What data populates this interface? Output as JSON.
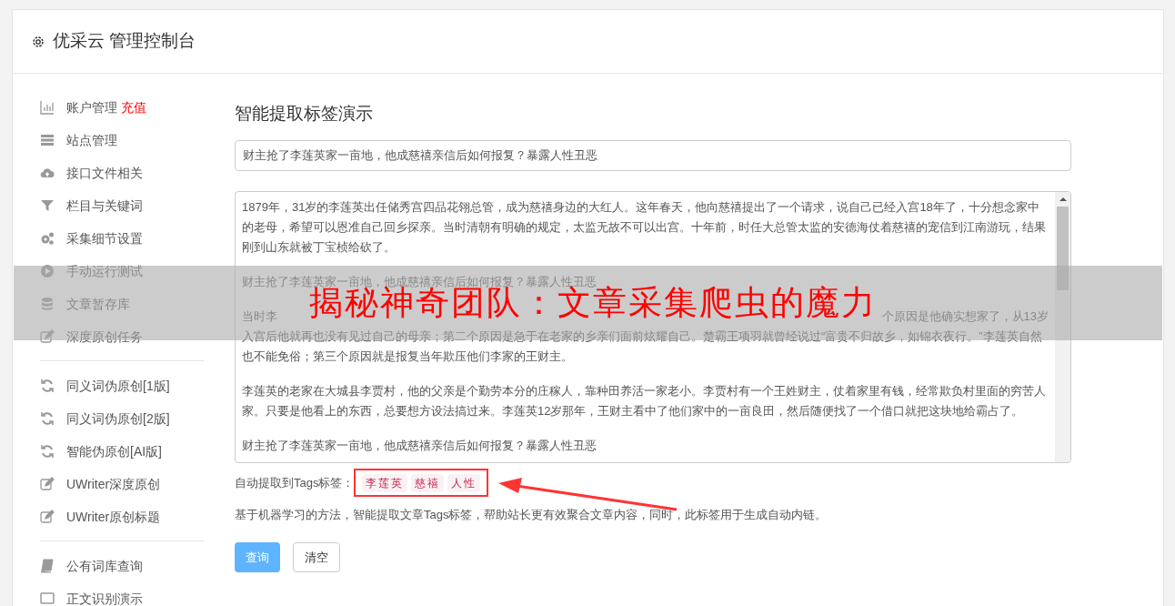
{
  "header": {
    "title": "优采云 管理控制台"
  },
  "sidebar": {
    "groups": [
      [
        {
          "label": "账户管理",
          "badge": "充值",
          "selected": false
        },
        {
          "label": "站点管理",
          "selected": false
        },
        {
          "label": "接口文件相关",
          "selected": false
        },
        {
          "label": "栏目与关键词",
          "selected": false
        },
        {
          "label": "采集细节设置",
          "selected": false
        },
        {
          "label": "手动运行测试",
          "selected": false
        },
        {
          "label": "文章暂存库",
          "selected": false
        },
        {
          "label": "深度原创任务",
          "selected": false
        }
      ],
      [
        {
          "label": "同义词伪原创[1版]",
          "selected": false
        },
        {
          "label": "同义词伪原创[2版]",
          "selected": false
        },
        {
          "label": "智能伪原创[AI版]",
          "selected": false
        },
        {
          "label": "UWriter深度原创",
          "selected": false
        },
        {
          "label": "UWriter原创标题",
          "selected": false
        }
      ],
      [
        {
          "label": "公有词库查询",
          "selected": false
        },
        {
          "label": "正文识别演示",
          "selected": false
        }
      ]
    ]
  },
  "main": {
    "heading": "智能提取标签演示",
    "title_field": {
      "value": "财主抢了李莲英家一亩地，他成慈禧亲信后如何报复？暴露人性丑恶"
    },
    "article": {
      "paragraphs": [
        {
          "kind": "text",
          "text": "1879年，31岁的李莲英出任储秀宫四品花翎总管，成为慈禧身边的大红人。这年春天，他向慈禧提出了一个请求，说自己已经入宫18年了，十分想念家中的老母，希望可以恩准自己回乡探亲。当时清朝有明确的规定，太监无故不可以出宫。十年前，时任大总管太监的安德海仗着慈禧的宠信到江南游玩，结果刚到山东就被丁宝桢给砍了。"
        },
        {
          "kind": "text",
          "text": "财主抢了李莲英家一亩地，他成慈禧亲信后如何报复？暴露人性丑恶"
        },
        {
          "kind": "covered",
          "start": "当时李",
          "end": "个原因是他确实想家了，从13岁",
          "text": "入宫后他就再也没有见过自己的母亲；第二个原因是急于在老家的乡亲们面前炫耀自己。楚霸王项羽就曾经说过“富贵不归故乡，如锦衣夜行。”李莲英自然也不能免俗；第三个原因就是报复当年欺压他们李家的王财主。"
        },
        {
          "kind": "text",
          "text": "李莲英的老家在大城县李贾村，他的父亲是个勤劳本分的庄稼人，靠种田养活一家老小。李贾村有一个王姓财主，仗着家里有钱，经常欺负村里面的穷苦人家。只要是他看上的东西，总要想方设法搞过来。李莲英12岁那年，王财主看中了他们家中的一亩良田，然后随便找了一个借口就把这块地给霸占了。"
        },
        {
          "kind": "text",
          "text": "财主抢了李莲英家一亩地，他成慈禧亲信后如何报复？暴露人性丑恶"
        }
      ]
    },
    "tags_label": "自动提取到Tags标签：",
    "tags": [
      "李莲英",
      "慈禧",
      "人性"
    ],
    "description": "基于机器学习的方法，智能提取文章Tags标签，帮助站长更有效聚合文章内容，同时，此标签用于生成自动内链。",
    "buttons": [
      {
        "label": "查询",
        "kind": "primary"
      },
      {
        "label": "清空",
        "kind": "default"
      }
    ]
  },
  "overlay_banner": {
    "text": "揭秘神奇团队：文章采集爬虫的魔力"
  }
}
